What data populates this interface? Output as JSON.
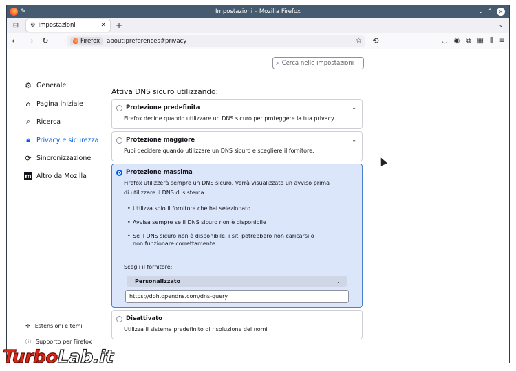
{
  "window": {
    "title": "Impostazioni – Mozilla Firefox"
  },
  "tabbar": {
    "tab_label": "Impostazioni"
  },
  "navbar": {
    "identity_label": "Firefox",
    "url": "about:preferences#privacy"
  },
  "sidebar": {
    "items": [
      {
        "label": "Generale",
        "icon": "gear-icon"
      },
      {
        "label": "Pagina iniziale",
        "icon": "home-icon"
      },
      {
        "label": "Ricerca",
        "icon": "search-icon"
      },
      {
        "label": "Privacy e sicurezza",
        "icon": "lock-icon",
        "selected": true
      },
      {
        "label": "Sincronizzazione",
        "icon": "sync-icon"
      },
      {
        "label": "Altro da Mozilla",
        "icon": "mozilla-icon"
      }
    ],
    "footer": [
      {
        "label": "Estensioni e temi",
        "icon": "puzzle-icon"
      },
      {
        "label": "Supporto per Firefox",
        "icon": "help-icon"
      }
    ]
  },
  "search": {
    "placeholder": "Cerca nelle impostazioni"
  },
  "dns": {
    "title": "Attiva DNS sicuro utilizzando:",
    "options": [
      {
        "label": "Protezione predefinita",
        "desc": "Firefox decide quando utilizzare un DNS sicuro per proteggere la tua privacy."
      },
      {
        "label": "Protezione maggiore",
        "desc": "Puoi decidere quando utilizzare un DNS sicuro e scegliere il fornitore."
      },
      {
        "label": "Protezione massima",
        "desc": "Firefox utilizzerà sempre un DNS sicuro. Verrà visualizzato un avviso prima di utilizzare il DNS di sistema.",
        "bullets": [
          "Utilizza solo il fornitore che hai selezionato",
          "Avvisa sempre se il DNS sicuro non è disponibile",
          "Se il DNS sicuro non è disponibile, i siti potrebbero non caricarsi o non funzionare correttamente"
        ],
        "provider_label": "Scegli il fornitore:",
        "provider_value": "Personalizzato",
        "custom_url": "https://doh.opendns.com/dns-query",
        "selected": true
      },
      {
        "label": "Disattivato",
        "desc": "Utilizza il sistema predefinito di risoluzione dei nomi"
      }
    ]
  },
  "watermark": {
    "part1": "Turbo",
    "part2": "Lab.it"
  },
  "colors": {
    "accent": "#0061e0",
    "selected_bg": "#dbe6fb",
    "titlebar": "#475b70"
  }
}
